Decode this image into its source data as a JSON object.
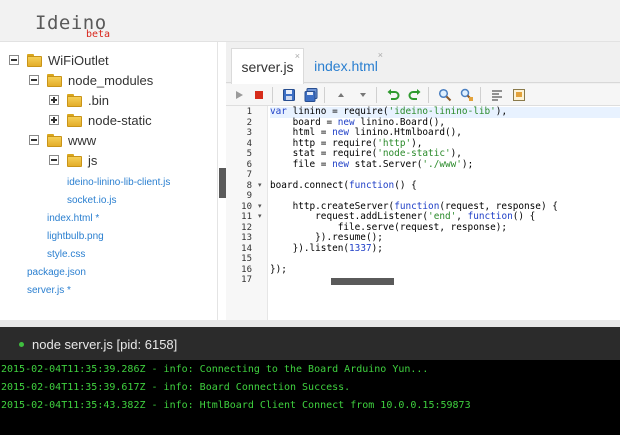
{
  "app": {
    "logo": "Ideino",
    "logo_badge": "beta"
  },
  "tree": {
    "root": {
      "label": "WiFiOutlet",
      "expanded": true
    },
    "node_modules": {
      "label": "node_modules",
      "expanded": true
    },
    "bin": {
      "label": ".bin",
      "expanded": false
    },
    "node_static": {
      "label": "node-static",
      "expanded": false
    },
    "www": {
      "label": "www",
      "expanded": true
    },
    "js": {
      "label": "js",
      "expanded": true
    },
    "files": [
      {
        "label": "ideino-linino-lib-client.js"
      },
      {
        "label": "socket.io.js"
      },
      {
        "label": "index.html *"
      },
      {
        "label": "lightbulb.png"
      },
      {
        "label": "style.css"
      },
      {
        "label": "package.json"
      },
      {
        "label": "server.js *"
      }
    ]
  },
  "editor": {
    "tabs": [
      {
        "label": "server.js",
        "active": true,
        "close": "×"
      },
      {
        "label": "index.html",
        "active": false,
        "close": "×"
      }
    ],
    "toolbar_icons": [
      "run-icon",
      "stop-icon",
      "save-icon",
      "save-all-icon",
      "move-up-icon",
      "move-down-icon",
      "undo-icon",
      "redo-icon",
      "search-icon",
      "replace-icon",
      "format-icon",
      "comment-icon"
    ],
    "code": [
      "var linino = require('ideino-linino-lib'),",
      "    board = new linino.Board(),",
      "    html = new linino.Htmlboard(),",
      "    http = require('http'),",
      "    stat = require('node-static'),",
      "    file = new stat.Server('./www');",
      "",
      "board.connect(function() {",
      "",
      "    http.createServer(function(request, response) {",
      "        request.addListener('end', function() {",
      "            file.serve(request, response);",
      "        }).resume();",
      "    }).listen(1337);",
      "",
      "});",
      ""
    ],
    "line_numbers": [
      "1",
      "2",
      "3",
      "4",
      "5",
      "6",
      "7",
      "8",
      "9",
      "10",
      "11",
      "12",
      "13",
      "14",
      "15",
      "16",
      "17"
    ],
    "fold_glyph": "▾"
  },
  "console": {
    "title": "node server.js [pid: 6158]",
    "logs": [
      "2015-02-04T11:35:39.286Z - info: Connecting to the Board Arduino Yun...",
      "2015-02-04T11:35:39.617Z - info: Board Connection Success.",
      "2015-02-04T11:35:43.382Z - info: HtmlBoard Client Connect from 10.0.0.15:59873"
    ],
    "status_color": "#3fbf3f",
    "log_color": "#3fd13f"
  }
}
